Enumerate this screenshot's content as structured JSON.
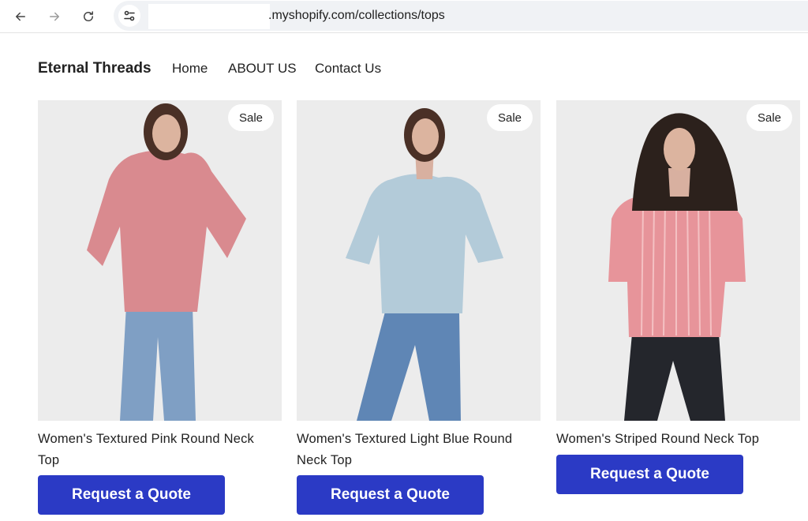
{
  "browser": {
    "url": ".myshopify.com/collections/tops",
    "icons": [
      "back-arrow-icon",
      "forward-arrow-icon",
      "reload-icon",
      "site-settings-icon"
    ]
  },
  "store": {
    "brand": "Eternal Threads",
    "nav": [
      "Home",
      "ABOUT US",
      "Contact Us"
    ]
  },
  "products": [
    {
      "badge": "Sale",
      "title": "Women's Textured Pink Round Neck Top",
      "button": "Request a Quote",
      "top_color": "#d98a8f",
      "jeans_color": "#7f9fc4"
    },
    {
      "badge": "Sale",
      "title": "Women's Textured Light Blue Round Neck Top",
      "button": "Request a Quote",
      "top_color": "#b3cbd9",
      "jeans_color": "#5f86b5"
    },
    {
      "badge": "Sale",
      "title": "Women's Striped Round Neck Top",
      "button": "Request a Quote",
      "top_color": "#e7949a",
      "jeans_color": "#24262c"
    }
  ],
  "colors": {
    "accent_button": "#2b3ac5",
    "image_background": "#eeeeee"
  }
}
